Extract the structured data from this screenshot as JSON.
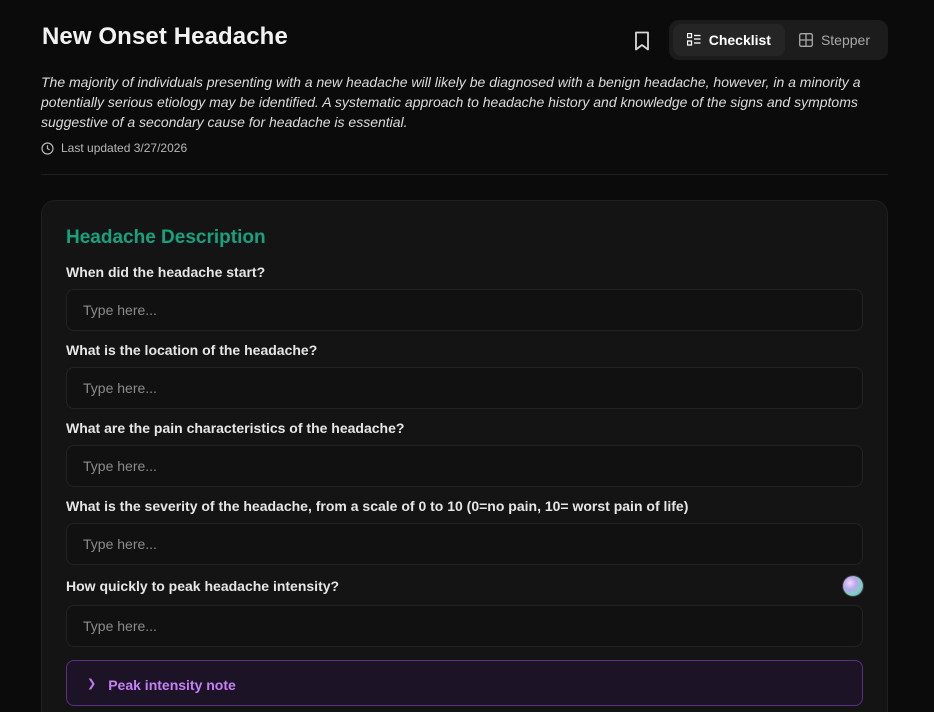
{
  "header": {
    "title": "New Onset Headache",
    "description": "The majority of individuals presenting with a new headache will likely be diagnosed with a benign headache, however, in a minority a potentially serious etiology may be identified. A systematic approach to headache history and knowledge of the signs and symptoms suggestive of a secondary cause for headache is essential.",
    "last_updated": "Last updated 3/27/2026"
  },
  "view_toggle": {
    "checklist_label": "Checklist",
    "stepper_label": "Stepper",
    "active": "Checklist"
  },
  "section": {
    "title": "Headache Description",
    "fields": [
      {
        "label": "When did the headache start?",
        "placeholder": "Type here..."
      },
      {
        "label": "What is the location of the headache?",
        "placeholder": "Type here..."
      },
      {
        "label": "What are the pain characteristics of the headache?",
        "placeholder": "Type here..."
      },
      {
        "label": "What is the severity of the headache, from a scale of 0 to 10 (0=no pain, 10= worst pain of life)",
        "placeholder": "Type here..."
      },
      {
        "label": "How quickly to peak headache intensity?",
        "placeholder": "Type here..."
      }
    ],
    "note_label": "Peak intensity note"
  },
  "icons": {
    "bookmark": "bookmark-icon",
    "checklist": "checklist-icon",
    "stepper": "grid-icon",
    "clock": "clock-icon",
    "chevron": "chevron-right-icon"
  },
  "colors": {
    "accent_green": "#15a37e",
    "accent_purple": "#c680f5",
    "background": "#0b0b0b",
    "card": "#141414"
  }
}
